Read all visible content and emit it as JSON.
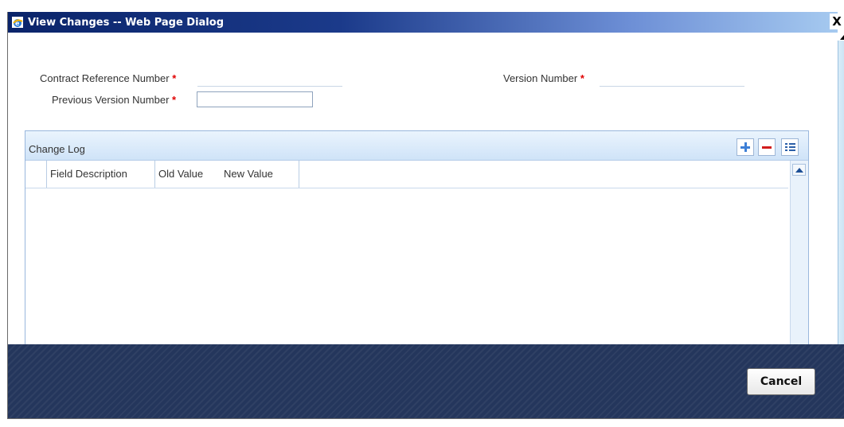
{
  "window": {
    "title": "View Changes -- Web Page Dialog",
    "close_glyph": "X"
  },
  "form": {
    "contract_ref_label": "Contract Reference Number",
    "contract_ref_value": "",
    "version_label": "Version Number",
    "version_value": "",
    "prev_version_label": "Previous Version Number",
    "prev_version_value": "",
    "required_marker": "*"
  },
  "change_log": {
    "title": "Change Log",
    "columns": [
      "Field Description",
      "Old Value",
      "New Value"
    ],
    "rows": [],
    "toolbar": [
      "add-icon",
      "delete-icon",
      "view-list-icon"
    ]
  },
  "footer": {
    "cancel_label": "Cancel"
  },
  "colors": {
    "titlebar": "#0a246a",
    "required": "#e00000",
    "footer": "#24365c"
  }
}
